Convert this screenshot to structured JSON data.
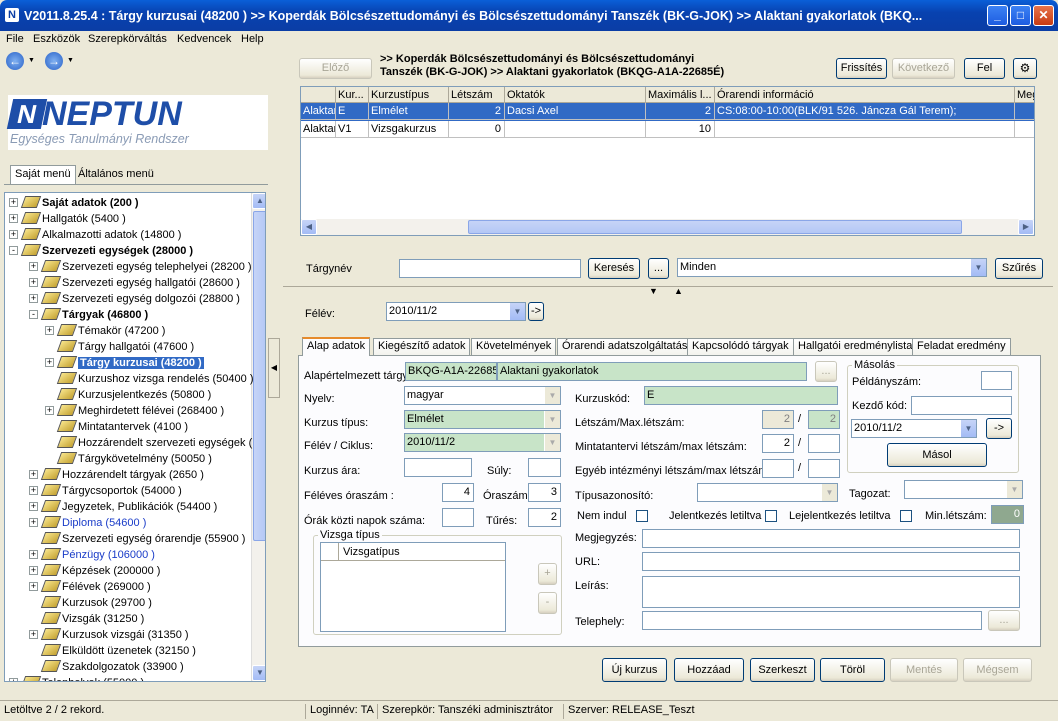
{
  "window": {
    "title": "V2011.8.25.4 : Tárgy kurzusai (48200 )  >> Koperdák Bölcsészettudományi és Bölcsészettudományi Tanszék (BK-G-JOK) >> Alaktani gyakorlatok (BKQ...",
    "app_icon": "N"
  },
  "menu": [
    "File",
    "Eszközök",
    "Szerepkörváltás",
    "Kedvencek",
    "Help"
  ],
  "logo": {
    "name": "NEPTUN",
    "tagline": "Egységes Tanulmányi Rendszer",
    "color": "#1e4ea8"
  },
  "left_tabs": [
    "Saját menü",
    "Általános menü"
  ],
  "tree": [
    {
      "label": "Saját adatok (200 )",
      "level": 0,
      "exp": "+",
      "bold": true
    },
    {
      "label": "Hallgatók (5400 )",
      "level": 0,
      "exp": "+"
    },
    {
      "label": "Alkalmazotti adatok (14800 )",
      "level": 0,
      "exp": "+"
    },
    {
      "label": "Szervezeti egységek (28000 )",
      "level": 0,
      "exp": "-",
      "bold": true
    },
    {
      "label": "Szervezeti egység telephelyei (28200 )",
      "level": 1,
      "exp": "+"
    },
    {
      "label": "Szervezeti egység hallgatói (28600 )",
      "level": 1,
      "exp": "+"
    },
    {
      "label": "Szervezeti egység dolgozói (28800 )",
      "level": 1,
      "exp": "+"
    },
    {
      "label": "Tárgyak (46800 )",
      "level": 1,
      "exp": "-",
      "bold": true
    },
    {
      "label": "Témakör (47200 )",
      "level": 2,
      "exp": "+"
    },
    {
      "label": "Tárgy hallgatói (47600 )",
      "level": 2
    },
    {
      "label": "Tárgy kurzusai (48200 )",
      "level": 2,
      "exp": "+",
      "bold": true,
      "selected": true
    },
    {
      "label": "Kurzushoz vizsga rendelés (50400 )",
      "level": 2
    },
    {
      "label": "Kurzusjelentkezés (50800 )",
      "level": 2
    },
    {
      "label": "Meghirdetett félévei (268400 )",
      "level": 2,
      "exp": "+"
    },
    {
      "label": "Mintatantervek (4100 )",
      "level": 2
    },
    {
      "label": "Hozzárendelt szervezeti egységek (",
      "level": 2
    },
    {
      "label": "Tárgykövetelmény (50050 )",
      "level": 2
    },
    {
      "label": "Hozzárendelt tárgyak (2650 )",
      "level": 1,
      "exp": "+"
    },
    {
      "label": "Tárgycsoportok (54000 )",
      "level": 1,
      "exp": "+"
    },
    {
      "label": "Jegyzetek, Publikációk (54400 )",
      "level": 1,
      "exp": "+"
    },
    {
      "label": "Diploma (54600 )",
      "level": 1,
      "exp": "+",
      "blue": true
    },
    {
      "label": "Szervezeti egység órarendje (55900 )",
      "level": 1
    },
    {
      "label": "Pénzügy (106000 )",
      "level": 1,
      "exp": "+",
      "blue": true
    },
    {
      "label": "Képzések (200000 )",
      "level": 1,
      "exp": "+"
    },
    {
      "label": "Félévek (269000 )",
      "level": 1,
      "exp": "+"
    },
    {
      "label": "Kurzusok (29700 )",
      "level": 1
    },
    {
      "label": "Vizsgák (31250 )",
      "level": 1
    },
    {
      "label": "Kurzusok vizsgái (31350 )",
      "level": 1,
      "exp": "+"
    },
    {
      "label": "Elküldött üzenetek (32150 )",
      "level": 1
    },
    {
      "label": "Szakdolgozatok (33900 )",
      "level": 1
    },
    {
      "label": "Telephelyek (55000 )",
      "level": 0,
      "exp": "+"
    }
  ],
  "nav": {
    "prev": "Előző",
    "path_line1": ">> Koperdák Bölcsészettudományi és Bölcsészettudományi",
    "path_line2": "Tanszék (BK-G-JOK) >> Alaktani gyakorlatok (BKQG-A1A-22685É)",
    "refresh": "Frissítés",
    "next": "Következő",
    "up": "Fel"
  },
  "grid": {
    "columns": [
      "",
      "Kur...",
      "Kurzustípus",
      "Létszám",
      "Oktatók",
      "Maximális l...",
      "Órarendi információ",
      "Meg"
    ],
    "rows": [
      [
        "Alaktar",
        "E",
        "Elmélet",
        "2",
        "Dacsi Axel",
        "2",
        "CS:08:00-10:00(BLK/91 526. Jáncza Gál Terem);",
        ""
      ],
      [
        "Alaktar",
        "V1",
        "Vizsgakurzus",
        "0",
        "",
        "10",
        "",
        ""
      ]
    ]
  },
  "search": {
    "label": "Tárgynév",
    "button": "Keresés",
    "ellipsis": "...",
    "filter": "Minden",
    "filter_button": "Szűrés"
  },
  "semester": {
    "label": "Félév:",
    "value": "2010/11/2",
    "go": "->"
  },
  "tabs": [
    "Alap adatok",
    "Kiegészítő adatok",
    "Követelmények",
    "Órarendi adatszolgáltatás",
    "Kapcsolódó tárgyak",
    "Hallgatói eredménylista",
    "Feladat eredmény"
  ],
  "form": {
    "alap_label": "Alapértelmezett tárgy:",
    "alap_code": "BKQG-A1A-22685",
    "alap_name": "Alaktani gyakorlatok",
    "alap_btn": "...",
    "nyelv_label": "Nyelv:",
    "nyelv": "magyar",
    "kurzus_tipus_label": "Kurzus típus:",
    "kurzus_tipus": "Elmélet",
    "felev_label": "Félév / Ciklus:",
    "felev": "2010/11/2",
    "ar_label": "Kurzus ára:",
    "ar": "",
    "suly_label": "Súly:",
    "suly": "",
    "oraszam_label": "Féléves óraszám :",
    "oraszam": "4",
    "oraszam2_label": "Óraszám:",
    "oraszam2": "3",
    "napok_label": "Órák közti napok száma:",
    "napok": "",
    "tures_label": "Tűrés:",
    "tures": "2",
    "vizsga_group": "Vizsga típus",
    "vizsga_col": "Vizsgatípus",
    "plus": "+",
    "minus": "-",
    "kurzuskod_label": "Kurzuskód:",
    "kurzuskod": "E",
    "letszam_label": "Létszám/Max.létszám:",
    "letszam": "2",
    "max_letszam": "2",
    "slash": "/",
    "mintatantervi_label": "Mintatantervi létszám/max létszám:",
    "mintatantervi": "2",
    "mintatantervi_max": "",
    "egyeb_label": "Egyéb intézményi létszám/max létszám:",
    "egyeb": "",
    "egyeb_max": "",
    "tipusazon_label": "Típusazonosító:",
    "tipusazon": "",
    "tagozat_label": "Tagozat:",
    "tagozat": "",
    "nem_indul_label": "Nem indul",
    "jelentkezes_label": "Jelentkezés letiltva",
    "lejelentkezes_label": "Lejelentkezés letiltva",
    "min_letszam_label": "Min.létszám:",
    "min_letszam": "0",
    "megjegyzes_label": "Megjegyzés:",
    "url_label": "URL:",
    "leiras_label": "Leírás:",
    "telephely_label": "Telephely:",
    "telephely_btn": "..."
  },
  "masolas": {
    "title": "Másolás",
    "peldany_label": "Példányszám:",
    "peldany": "",
    "kezdo_label": "Kezdő kód:",
    "kezdo": "",
    "felev": "2010/11/2",
    "go": "->",
    "button": "Másol"
  },
  "actions": {
    "new": "Új kurzus",
    "add": "Hozzáad",
    "edit": "Szerkeszt",
    "delete": "Töröl",
    "save": "Mentés",
    "cancel": "Mégsem"
  },
  "status": {
    "left": "Letöltve 2 / 2 rekord.",
    "login": "Loginnév: TA",
    "role": "Szerepkör: Tanszéki adminisztrátor",
    "server": "Szerver: RELEASE_Teszt"
  }
}
